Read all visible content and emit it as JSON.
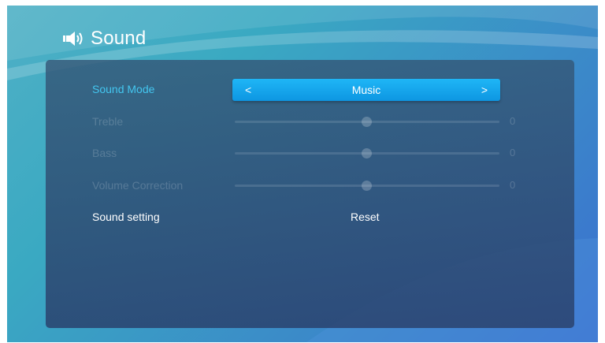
{
  "header": {
    "title": "Sound",
    "icon": "speaker-icon"
  },
  "sound_mode": {
    "label": "Sound Mode",
    "value": "Music",
    "prev": "<",
    "next": ">"
  },
  "sliders": [
    {
      "label": "Treble",
      "value": "0",
      "level": 0.5
    },
    {
      "label": "Bass",
      "value": "0",
      "level": 0.5
    },
    {
      "label": "Volume Correction",
      "value": "0",
      "level": 0.5
    }
  ],
  "sound_setting": {
    "label": "Sound setting",
    "action": "Reset"
  },
  "colors": {
    "accent": "#43c6ef",
    "selector": "#0d96e2",
    "panel": "#2f4e78"
  }
}
